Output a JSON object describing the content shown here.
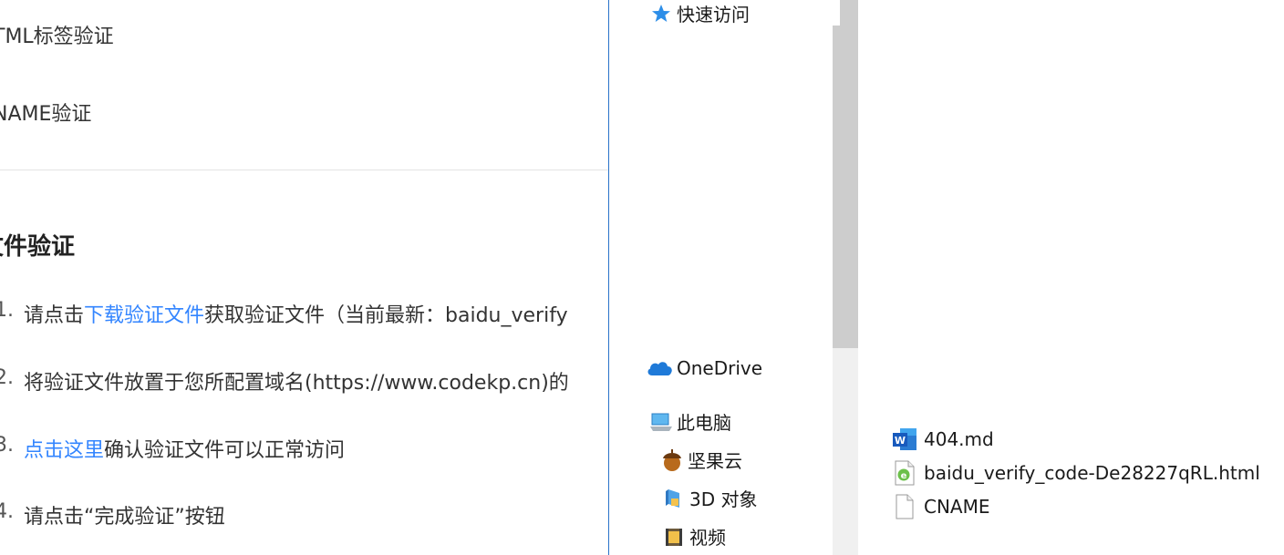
{
  "webpage": {
    "methods": [
      {
        "label": "TML标签验证"
      },
      {
        "label": "NAME验证"
      }
    ],
    "section_title": "文件验证",
    "steps": [
      {
        "num": "1.",
        "pre": "请点击",
        "link": "下载验证文件",
        "post": "获取验证文件（当前最新：baidu_verify"
      },
      {
        "num": "2.",
        "text": "将验证文件放置于您所配置域名(https://www.codekp.cn)的"
      },
      {
        "num": "3.",
        "link": "点击这里",
        "post": "确认验证文件可以正常访问"
      },
      {
        "num": "4.",
        "text": "请点击“完成验证”按钮"
      }
    ],
    "link_color": "#3385ff"
  },
  "dialog": {
    "nav": {
      "quick_access": "快速访问",
      "onedrive": "OneDrive",
      "this_pc": "此电脑",
      "jianguoyun": "坚果云",
      "objects_3d": "3D 对象",
      "videos": "视频"
    },
    "files": [
      {
        "name": "404.md",
        "icon": "word-doc-icon"
      },
      {
        "name": "baidu_verify_code-De28227qRL.html",
        "icon": "edge-html-icon"
      },
      {
        "name": "CNAME",
        "icon": "blank-file-icon"
      }
    ]
  }
}
